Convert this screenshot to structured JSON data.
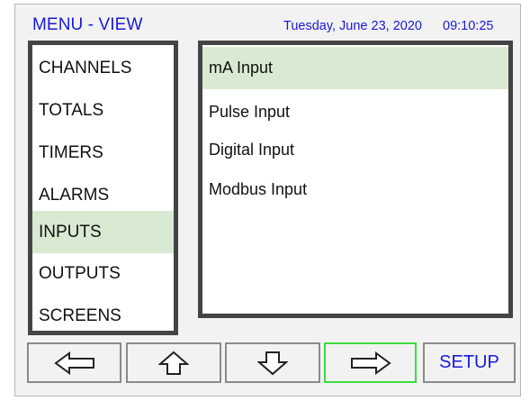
{
  "header": {
    "title": "MENU - VIEW",
    "date": "Tuesday, June 23, 2020",
    "time": "09:10:25"
  },
  "menu": {
    "items": [
      {
        "label": "CHANNELS",
        "selected": false
      },
      {
        "label": "TOTALS",
        "selected": false
      },
      {
        "label": "TIMERS",
        "selected": false
      },
      {
        "label": "ALARMS",
        "selected": false
      },
      {
        "label": "INPUTS",
        "selected": true
      },
      {
        "label": "OUTPUTS",
        "selected": false
      },
      {
        "label": "SCREENS",
        "selected": false
      }
    ]
  },
  "submenu": {
    "items": [
      {
        "label": "mA Input",
        "selected": true
      },
      {
        "label": "Pulse Input",
        "selected": false
      },
      {
        "label": "Digital Input",
        "selected": false
      },
      {
        "label": "Modbus Input",
        "selected": false
      }
    ]
  },
  "buttons": {
    "left_icon": "arrow-left-icon",
    "up_icon": "arrow-up-icon",
    "down_icon": "arrow-down-icon",
    "right_icon": "arrow-right-icon",
    "setup_label": "SETUP"
  },
  "colors": {
    "accent_text": "#1a1adb",
    "selection_bg": "#d9ead3",
    "panel_border": "#444444",
    "active_button_border": "#3ddc3d"
  }
}
